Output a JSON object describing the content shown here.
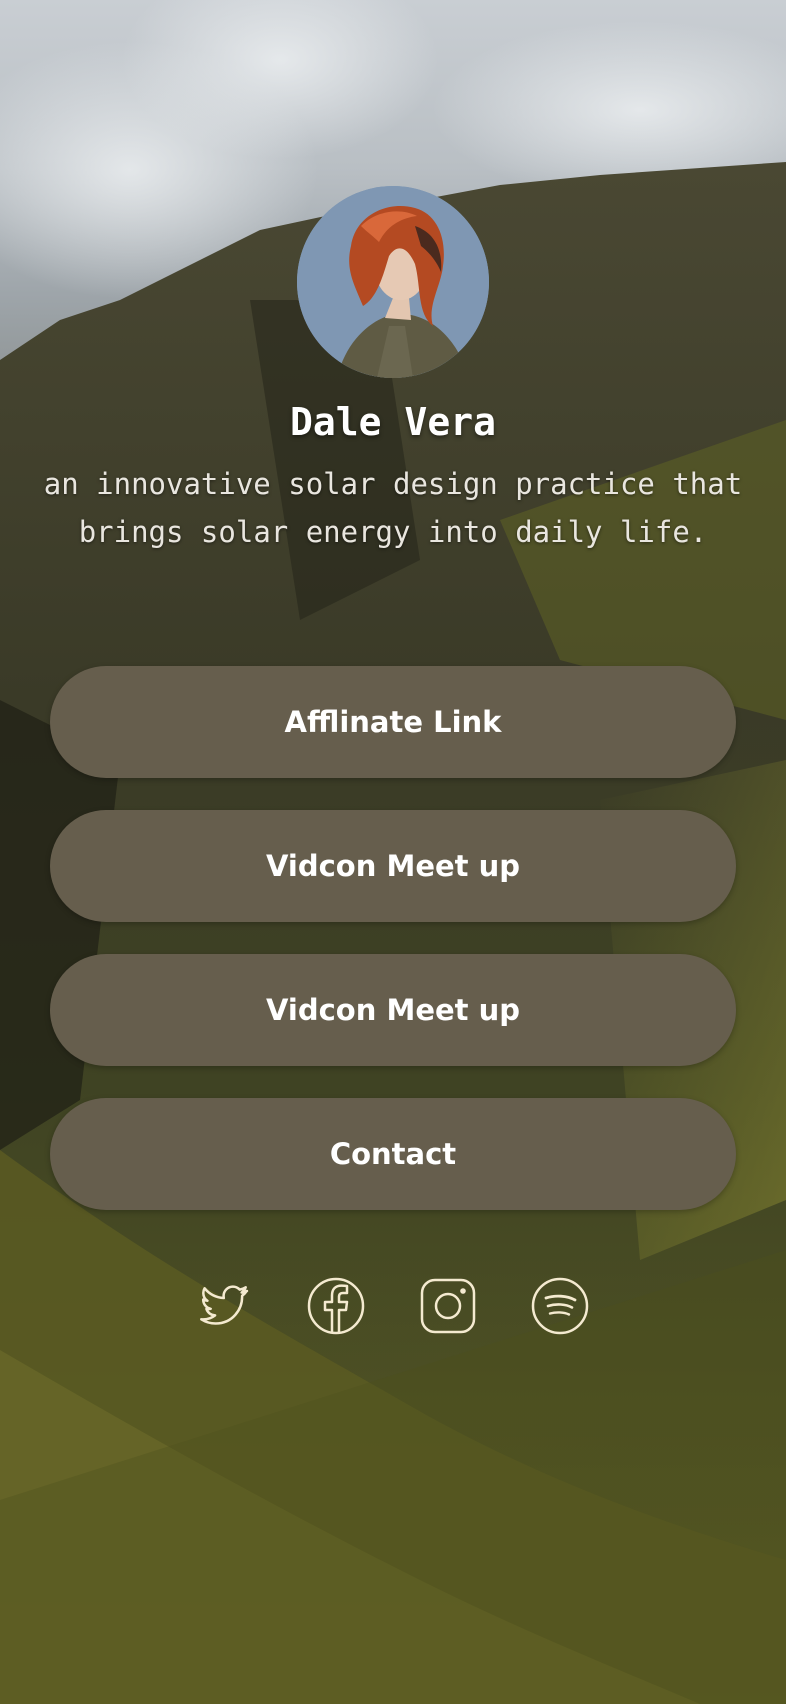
{
  "profile": {
    "name": "Dale Vera",
    "bio": "an innovative solar design practice that brings solar energy into daily life.",
    "avatar_icon": "profile-photo"
  },
  "links": [
    {
      "label": "Afflinate Link"
    },
    {
      "label": "Vidcon Meet up"
    },
    {
      "label": "Vidcon Meet up"
    },
    {
      "label": "Contact"
    }
  ],
  "social": [
    {
      "icon": "twitter-icon"
    },
    {
      "icon": "facebook-icon"
    },
    {
      "icon": "instagram-icon"
    },
    {
      "icon": "spotify-icon"
    }
  ],
  "colors": {
    "button_bg": "#665e4d",
    "button_text": "#ffffff",
    "icon_stroke": "#f4ead0"
  }
}
